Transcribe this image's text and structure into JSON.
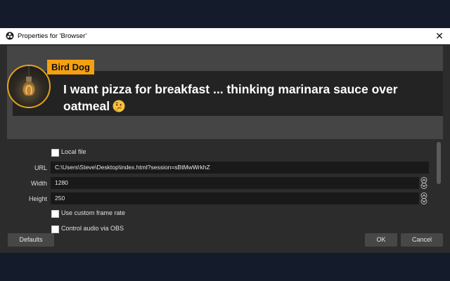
{
  "window": {
    "title": "Properties for 'Browser'",
    "close_glyph": "✕",
    "icon": "obs-logo-icon"
  },
  "preview": {
    "name_tag": "Bird Dog",
    "message": "I want pizza for breakfast ... thinking marinara sauce over oatmeal",
    "emoji": "thinking-face-emoji",
    "colors": {
      "tag": "#f5a10f",
      "card": "#232323",
      "text": "#ffffff"
    }
  },
  "form": {
    "local_file_label": "Local file",
    "url_label": "URL",
    "url_value": "C:\\Users\\Steve\\Desktop\\index.html?session=sBtMwWrkhZ",
    "width_label": "Width",
    "width_value": "1280",
    "height_label": "Height",
    "height_value": "250",
    "custom_frame_rate_label": "Use custom frame rate",
    "control_audio_label": "Control audio via OBS"
  },
  "buttons": {
    "defaults": "Defaults",
    "ok": "OK",
    "cancel": "Cancel"
  }
}
